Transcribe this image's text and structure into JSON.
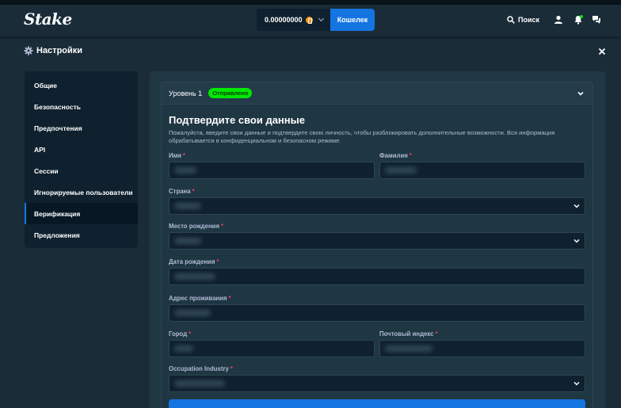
{
  "header": {
    "logo": "Stake",
    "balance": "0.00000000",
    "wallet_label": "Кошелек",
    "search_label": "Поиск"
  },
  "settings": {
    "title": "Настройки"
  },
  "sidebar": {
    "items": [
      {
        "label": "Общие"
      },
      {
        "label": "Безопасность"
      },
      {
        "label": "Предпочтения"
      },
      {
        "label": "API"
      },
      {
        "label": "Сессии"
      },
      {
        "label": "Игнорируемые пользователи"
      },
      {
        "label": "Верификация",
        "active": true
      },
      {
        "label": "Предложения"
      }
    ]
  },
  "verification": {
    "level": "Уровень 1",
    "status": "Отправлено",
    "form_title": "Подтвердите свои данные",
    "form_description": "Пожалуйста, введите свои данные и подтвердите свою личность, чтобы разблокировать дополнительные возможности. Вся информация обрабатывается в конфиденциальном и безопасном режиме.",
    "fields": {
      "first_name": "Имя",
      "last_name": "Фамилия",
      "country": "Страна",
      "birth_place": "Место рождения",
      "birth_date": "Дата рождения",
      "address": "Адрес проживания",
      "city": "Город",
      "postal_code": "Почтовый индекс",
      "occupation": "Occupation Industry"
    },
    "required_mark": "*"
  },
  "colors": {
    "accent": "#1475e1",
    "status_green": "#00e701",
    "background": "#1a2c38"
  }
}
